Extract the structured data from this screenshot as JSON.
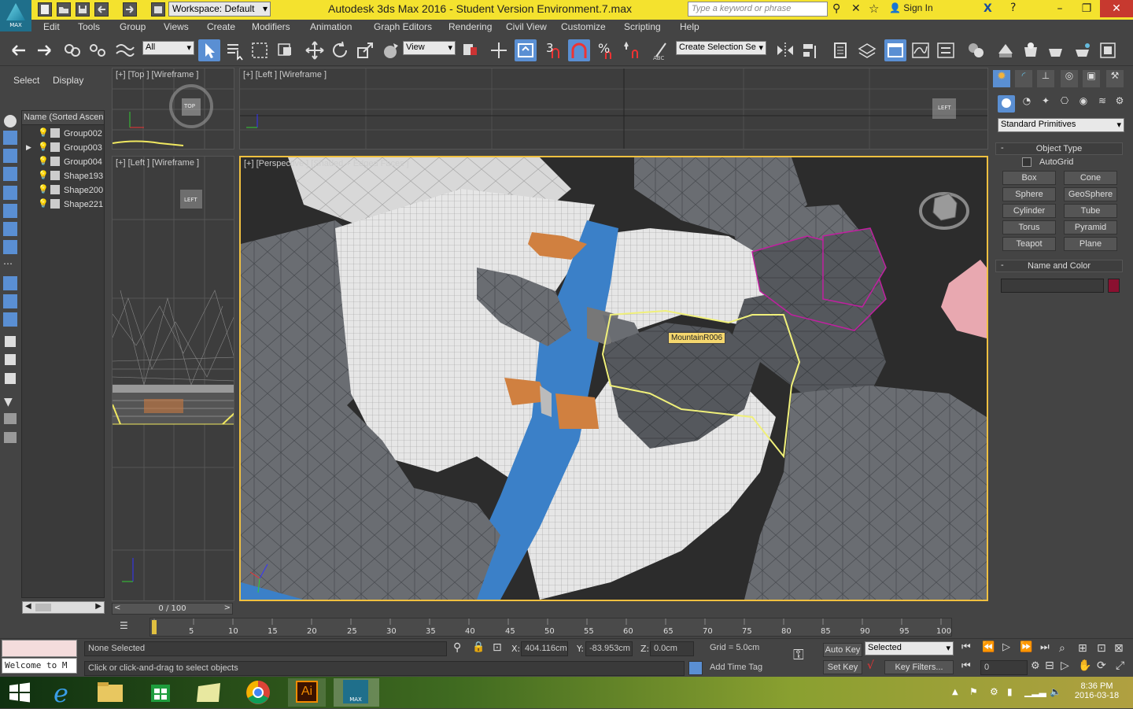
{
  "titlebar": {
    "workspace": "Workspace: Default",
    "title": "Autodesk 3ds Max 2016 - Student Version     Environment.7.max",
    "search_placeholder": "Type a keyword or phrase",
    "signin": "Sign In",
    "logo_text": "MAX"
  },
  "menus": [
    "Edit",
    "Tools",
    "Group",
    "Views",
    "Create",
    "Modifiers",
    "Animation",
    "Graph Editors",
    "Rendering",
    "Civil View",
    "Customize",
    "Scripting",
    "Help"
  ],
  "toolbar": {
    "filter": "All",
    "refcoord": "View",
    "named_selection": "Create Selection Se",
    "snap_label": "3"
  },
  "scene_explorer": {
    "tabs": [
      "Select",
      "Display"
    ],
    "column_header": "Name (Sorted Ascend",
    "items": [
      "Group002",
      "Group003",
      "Group004",
      "Shape193",
      "Shape200",
      "Shape221"
    ]
  },
  "viewports": {
    "top": "[+] [Top ] [Wireframe ]",
    "left_small": "[+] [Left ] [Wireframe ]",
    "left_large": "[+] [Left ] [Wireframe ]",
    "perspective": "[+] [Perspective ] [Shaded + Edged Faces ]",
    "object_tooltip": "MountainR006",
    "viewcube_top": "TOP",
    "viewcube_left": "LEFT"
  },
  "command_panel": {
    "category": "Standard Primitives",
    "object_type_title": "Object Type",
    "autogrid": "AutoGrid",
    "buttons": [
      [
        "Box",
        "Cone"
      ],
      [
        "Sphere",
        "GeoSphere"
      ],
      [
        "Cylinder",
        "Tube"
      ],
      [
        "Torus",
        "Pyramid"
      ],
      [
        "Teapot",
        "Plane"
      ]
    ],
    "name_color_title": "Name and Color",
    "color": "#8a1030"
  },
  "timeline": {
    "frame_counter": "0 / 100",
    "ticks": [
      "5",
      "10",
      "15",
      "20",
      "25",
      "30",
      "35",
      "40",
      "45",
      "50",
      "55",
      "60",
      "65",
      "70",
      "75",
      "80",
      "85",
      "90",
      "95",
      "100"
    ]
  },
  "status": {
    "maxscript": "Welcome to M",
    "selection": "None Selected",
    "prompt": "Click or click-and-drag to select objects",
    "x_label": "X:",
    "x": "404.116cm",
    "y_label": "Y:",
    "y": "-83.953cm",
    "z_label": "Z:",
    "z": "0.0cm",
    "grid": "Grid = 5.0cm",
    "add_time_tag": "Add Time Tag",
    "auto_key": "Auto Key",
    "set_key": "Set Key",
    "key_mode": "Selected",
    "key_filters": "Key Filters...",
    "frame": "0"
  },
  "taskbar": {
    "time": "8:36 PM",
    "date": "2016-03-18",
    "ai_label": "Ai",
    "max_label": "MAX"
  }
}
